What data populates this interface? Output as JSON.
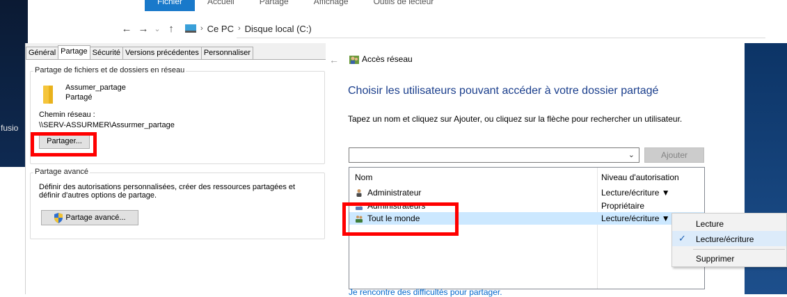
{
  "desktop": {
    "left_text": "fusio"
  },
  "ribbon": {
    "tabs": [
      "Fichier",
      "Accueil",
      "Partage",
      "Affichage",
      "Outils de lecteur"
    ]
  },
  "address": {
    "crumbs": [
      "Ce PC",
      "Disque local (C:)"
    ]
  },
  "properties": {
    "tabs": [
      "Général",
      "Partage",
      "Sécurité",
      "Versions précédentes",
      "Personnaliser"
    ],
    "active_tab": "Partage",
    "network_group": {
      "legend": "Partage de fichiers et de dossiers en réseau",
      "folder_name": "Assumer_partage",
      "folder_status": "Partagé",
      "path_label": "Chemin réseau :",
      "path_value": "\\\\SERV-ASSURMER\\Assurmer_partage",
      "share_button": "Partager..."
    },
    "advanced_group": {
      "legend": "Partage avancé",
      "description": "Définir des autorisations personnalisées, créer des ressources partagées et définir d'autres options de partage.",
      "button": "Partage avancé..."
    }
  },
  "wizard": {
    "title": "Accès réseau",
    "heading": "Choisir les utilisateurs pouvant accéder à votre dossier partagé",
    "instruction": "Tapez un nom et cliquez sur Ajouter, ou cliquez sur la flèche pour rechercher un utilisateur.",
    "combo_value": "",
    "add_button": "Ajouter",
    "columns": {
      "name": "Nom",
      "permission": "Niveau d'autorisation"
    },
    "rows": [
      {
        "name": "Administrateur",
        "permission": "Lecture/écriture ▼"
      },
      {
        "name": "Administrateurs",
        "permission": "Propriétaire"
      },
      {
        "name": "Tout le monde",
        "permission": "Lecture/écriture ▼"
      }
    ],
    "help_link": "Je rencontre des difficultés pour partager."
  },
  "context_menu": {
    "items": [
      "Lecture",
      "Lecture/écriture",
      "Supprimer"
    ],
    "checked": "Lecture/écriture"
  },
  "colors": {
    "highlight": "#ff0000",
    "selection": "#cce8ff",
    "heading": "#1a3e8c"
  }
}
